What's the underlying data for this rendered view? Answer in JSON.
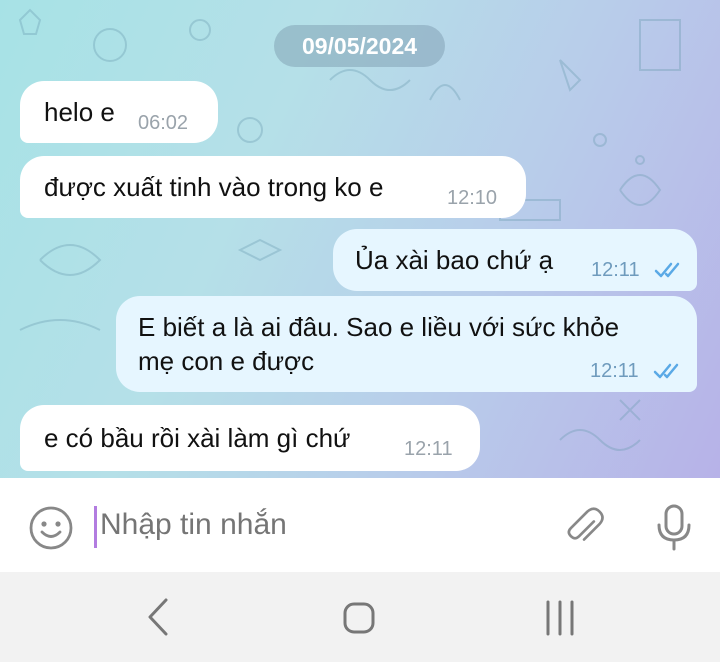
{
  "chat": {
    "date": "09/05/2024",
    "messages": [
      {
        "direction": "incoming",
        "text": "helo e",
        "time": "06:02"
      },
      {
        "direction": "incoming",
        "text": "được xuất tinh vào trong ko e",
        "time": "12:10"
      },
      {
        "direction": "outgoing",
        "text": "Ủa xài bao chứ ạ",
        "time": "12:11",
        "status": "read"
      },
      {
        "direction": "outgoing",
        "text_line1": "E biết a là ai đâu. Sao e liều với sức khỏe",
        "text_line2": "mẹ con e được",
        "time": "12:11",
        "status": "read"
      },
      {
        "direction": "incoming",
        "text": "e có bầu rồi xài làm gì chứ",
        "time": "12:11"
      }
    ]
  },
  "composer": {
    "placeholder": "Nhập tin nhắn",
    "emoji_icon": "emoji-icon",
    "attach_icon": "paperclip-icon",
    "mic_icon": "microphone-icon"
  },
  "navbar": {
    "back_icon": "back-icon",
    "home_icon": "home-icon",
    "recents_icon": "recents-icon"
  },
  "colors": {
    "bubble_incoming": "#ffffff",
    "bubble_outgoing": "#e6f6ff",
    "read_ticks": "#5aa9e6",
    "cursor": "#b27ce0"
  }
}
